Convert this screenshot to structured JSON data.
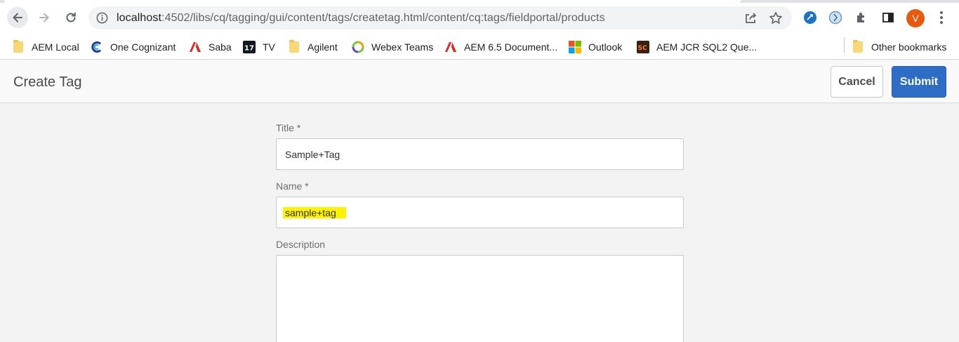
{
  "browser": {
    "url_host": "localhost",
    "url_rest": ":4502/libs/cq/tagging/gui/content/tags/createtag.html/content/cq:tags/fieldportal/products",
    "icons": {
      "back": "arrow-left-icon",
      "forward": "arrow-right-icon",
      "reload": "reload-icon",
      "site_info": "info-icon",
      "share": "share-icon",
      "bookmark": "star-icon",
      "extensions": "puzzle-icon",
      "side_panel": "side-panel-icon",
      "menu": "three-dots-icon"
    },
    "profile_initial": "V",
    "profile_color": "#e8590c"
  },
  "bookmarks": {
    "items": [
      {
        "label": "AEM Local",
        "icon": "folder-icon"
      },
      {
        "label": "One Cognizant",
        "icon": "cognizant-icon"
      },
      {
        "label": "Saba",
        "icon": "adobe-icon"
      },
      {
        "label": "TV",
        "icon": "tradingview-icon"
      },
      {
        "label": "Agilent",
        "icon": "folder-icon"
      },
      {
        "label": "Webex Teams",
        "icon": "webex-icon"
      },
      {
        "label": "AEM 6.5 Document...",
        "icon": "adobe-icon"
      },
      {
        "label": "Outlook",
        "icon": "microsoft-icon"
      },
      {
        "label": "AEM JCR SQL2 Que...",
        "icon": "sc-icon"
      }
    ],
    "other": {
      "label": "Other bookmarks",
      "icon": "folder-icon"
    }
  },
  "page": {
    "title": "Create Tag",
    "cancel_label": "Cancel",
    "submit_label": "Submit",
    "accent_color": "#2e6dc6"
  },
  "form": {
    "title_label": "Title *",
    "title_value": "Sample+Tag",
    "name_label": "Name *",
    "name_value": "sample+tag",
    "description_label": "Description",
    "description_value": ""
  }
}
